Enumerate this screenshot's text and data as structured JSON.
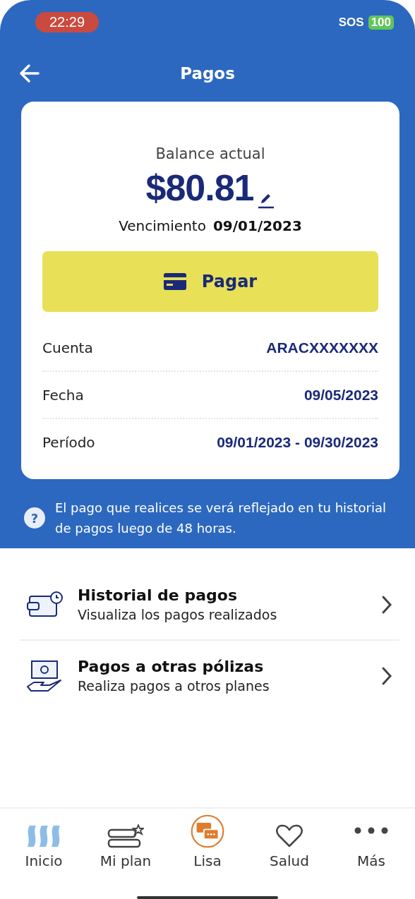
{
  "status_bar": {
    "time": "22:29",
    "carrier": "SOS",
    "battery": "100"
  },
  "header": {
    "title": "Pagos"
  },
  "balance": {
    "label": "Balance actual",
    "amount": "$80.81",
    "due_label": "Vencimiento",
    "due_date": "09/01/2023",
    "pay_button": "Pagar"
  },
  "details": [
    {
      "label": "Cuenta",
      "value": "ARACXXXXXXX"
    },
    {
      "label": "Fecha",
      "value": "09/05/2023"
    },
    {
      "label": "Período",
      "value": "09/01/2023 - 09/30/2023"
    }
  ],
  "notice_icon": "?",
  "notice": "El pago que realices se verá reflejado en tu historial de pagos luego de 48 horas.",
  "menu": [
    {
      "kind": "history",
      "title": "Historial de pagos",
      "subtitle": "Visualiza los pagos realizados"
    },
    {
      "kind": "money",
      "title": "Pagos a otras pólizas",
      "subtitle": "Realiza pagos a otros planes"
    }
  ],
  "tabs": [
    {
      "kind": "home",
      "label": "Inicio"
    },
    {
      "kind": "plan",
      "label": "Mi plan"
    },
    {
      "kind": "chat",
      "label": "Lisa"
    },
    {
      "kind": "heart",
      "label": "Salud"
    },
    {
      "kind": "more",
      "label": "Más"
    }
  ]
}
